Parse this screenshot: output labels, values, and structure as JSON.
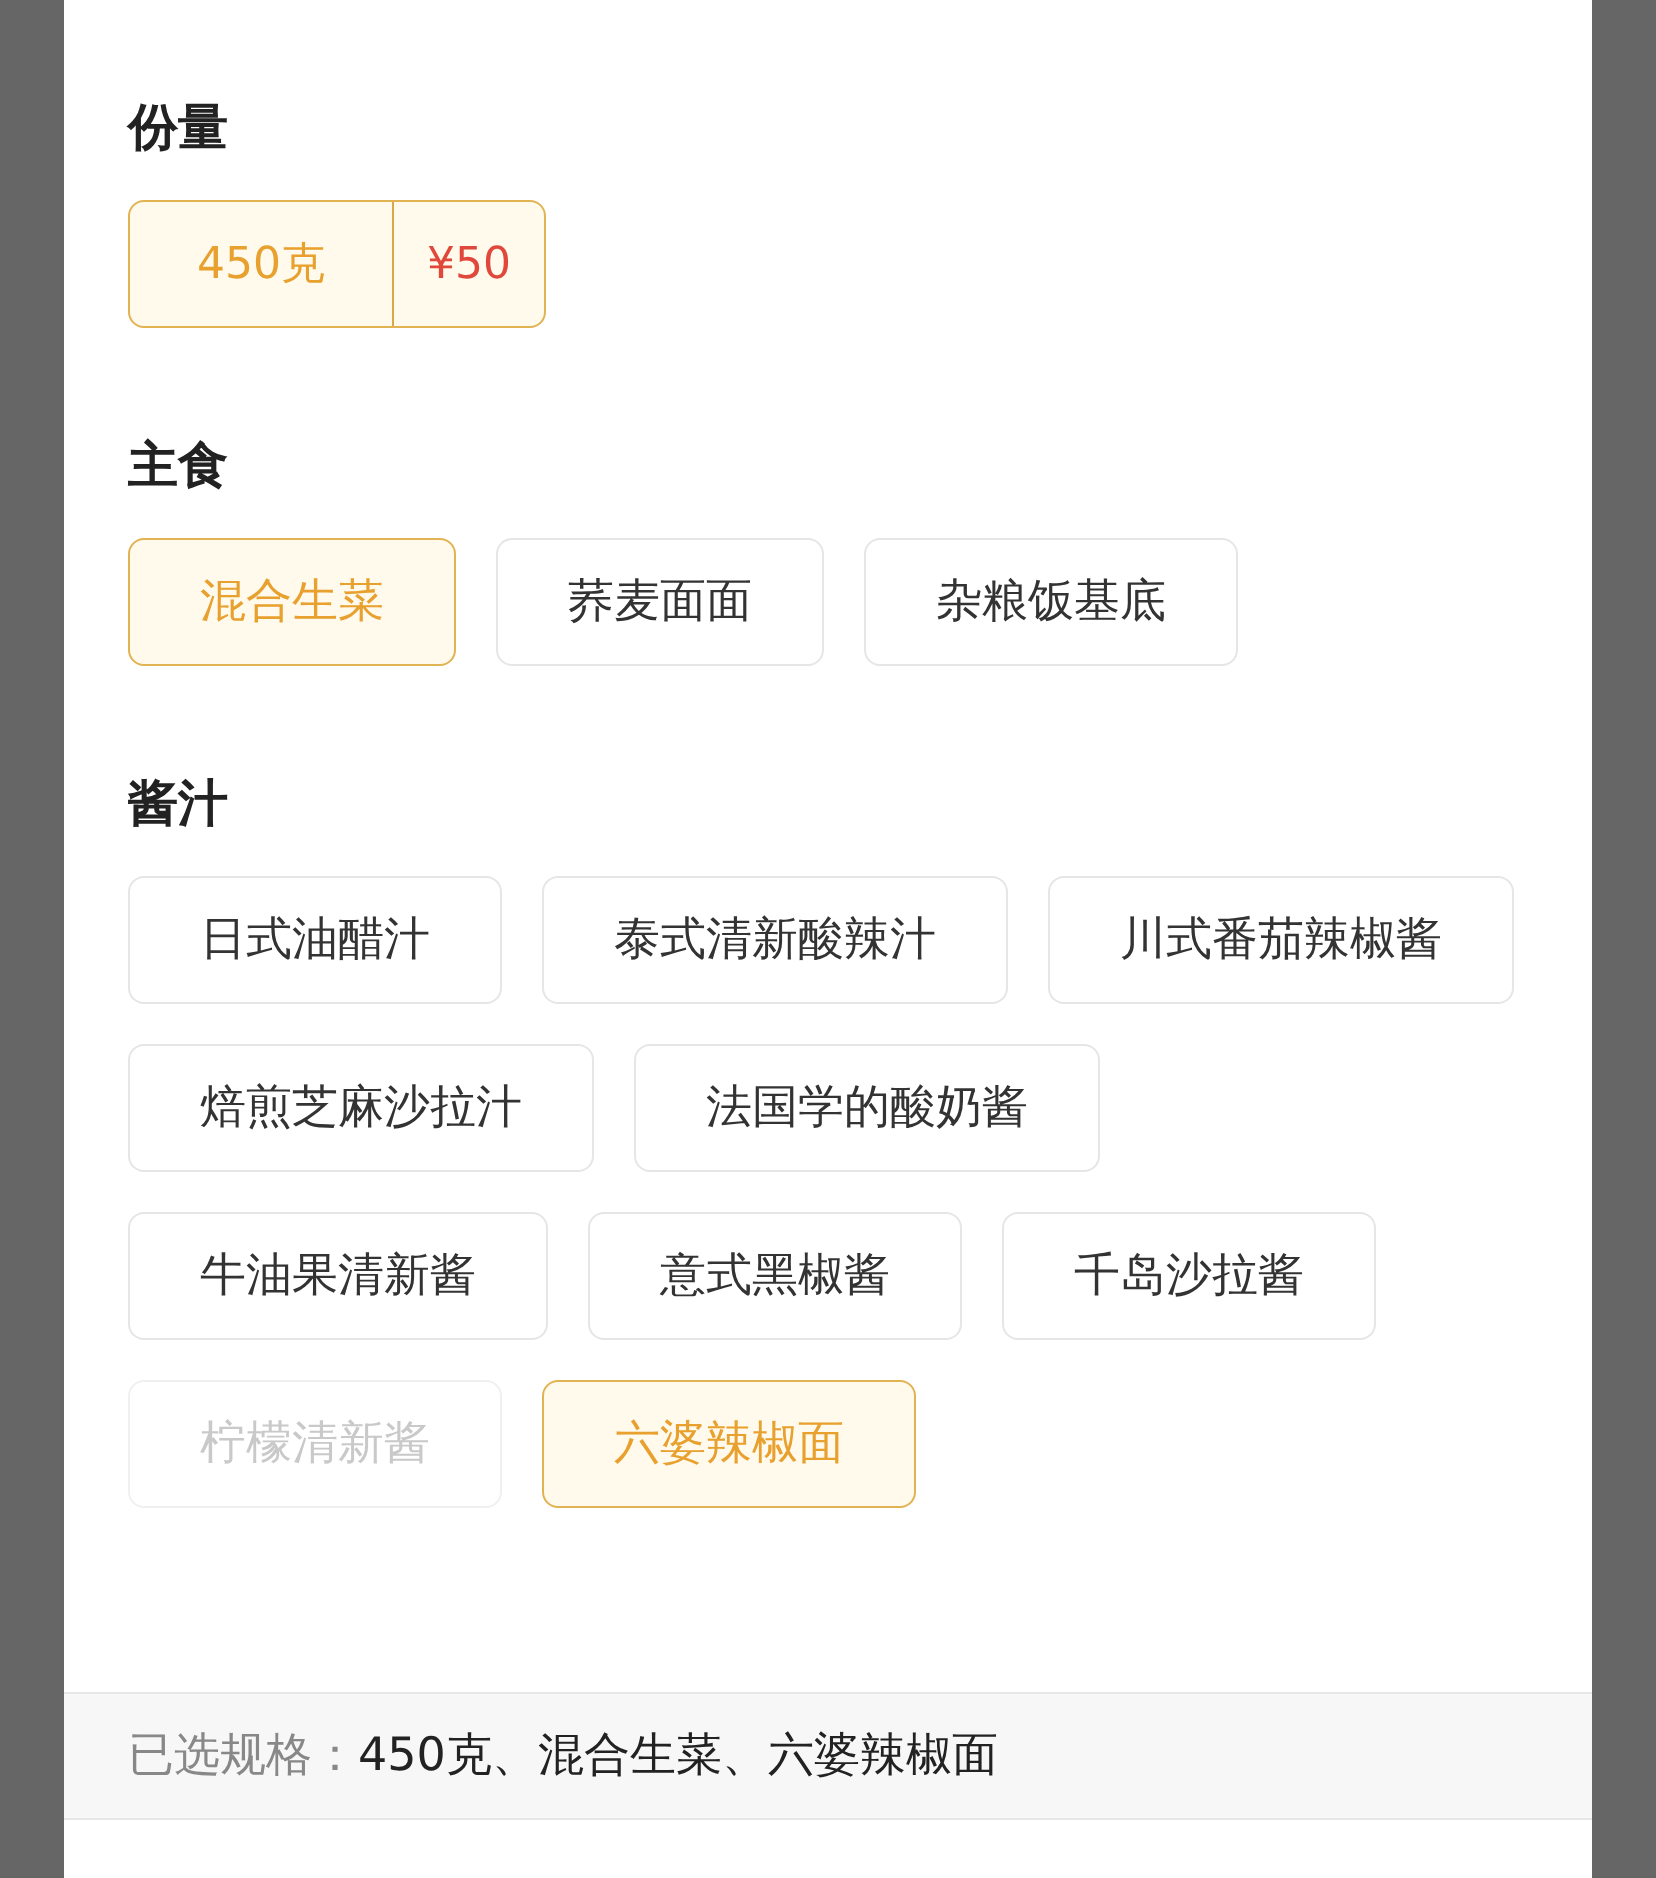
{
  "sections": [
    {
      "title": "份量",
      "kind": "portion",
      "options": [
        {
          "label": "450克",
          "price": "¥50",
          "selected": true,
          "disabled": false
        }
      ]
    },
    {
      "title": "主食",
      "kind": "plain",
      "options": [
        {
          "label": "混合生菜",
          "selected": true,
          "disabled": false
        },
        {
          "label": "荞麦面面",
          "selected": false,
          "disabled": false
        },
        {
          "label": "杂粮饭基底",
          "selected": false,
          "disabled": false
        }
      ]
    },
    {
      "title": "酱汁",
      "kind": "plain",
      "options": [
        {
          "label": "日式油醋汁",
          "selected": false,
          "disabled": false
        },
        {
          "label": "泰式清新酸辣汁",
          "selected": false,
          "disabled": false
        },
        {
          "label": "川式番茄辣椒酱",
          "selected": false,
          "disabled": false
        },
        {
          "label": "焙煎芝麻沙拉汁",
          "selected": false,
          "disabled": false
        },
        {
          "label": "法国学的酸奶酱",
          "selected": false,
          "disabled": false
        },
        {
          "label": "牛油果清新酱",
          "selected": false,
          "disabled": false
        },
        {
          "label": "意式黑椒酱",
          "selected": false,
          "disabled": false
        },
        {
          "label": "千岛沙拉酱",
          "selected": false,
          "disabled": false
        },
        {
          "label": "柠檬清新酱",
          "selected": false,
          "disabled": true
        },
        {
          "label": "六婆辣椒面",
          "selected": true,
          "disabled": false
        }
      ]
    }
  ],
  "summary": {
    "label": "已选规格：",
    "value": "450克、混合生菜、六婆辣椒面"
  }
}
